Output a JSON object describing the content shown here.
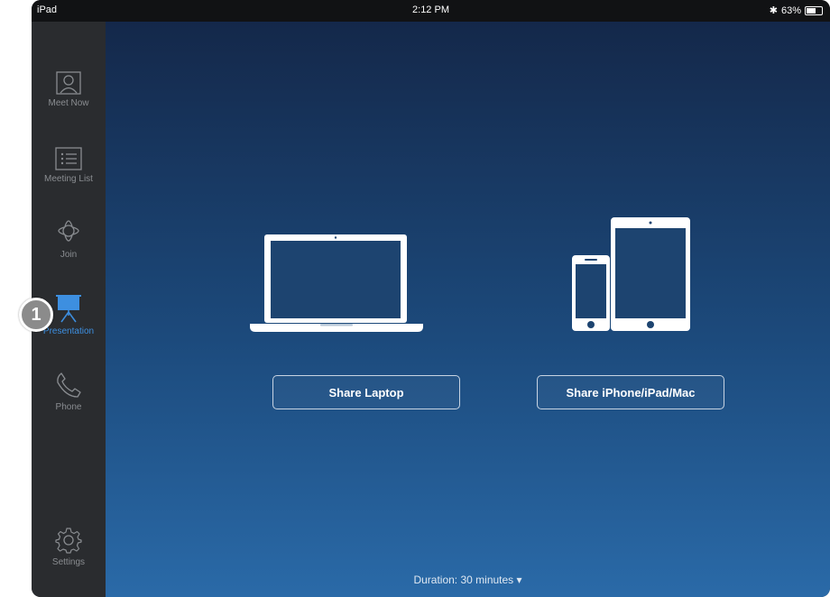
{
  "status_bar": {
    "device": "iPad",
    "time": "2:12 PM",
    "battery": "63%",
    "battery_level": 0.63
  },
  "sidebar": {
    "items": [
      {
        "label": "Meet Now",
        "icon": "person-icon"
      },
      {
        "label": "Meeting List",
        "icon": "list-icon"
      },
      {
        "label": "Join",
        "icon": "join-icon"
      },
      {
        "label": "Presentation",
        "icon": "projector-icon"
      },
      {
        "label": "Phone",
        "icon": "phone-icon"
      }
    ],
    "settings": {
      "label": "Settings",
      "icon": "gear-icon"
    },
    "active_index": 3
  },
  "main": {
    "share_laptop_label": "Share Laptop",
    "share_devices_label": "Share iPhone/iPad/Mac",
    "duration": "Duration: 30 minutes ▾"
  },
  "annotation": {
    "step": "1"
  },
  "colors": {
    "accent": "#3d8fe0",
    "sidebar_bg": "#2a2c2f",
    "main_gradient_top": "#14284a",
    "main_gradient_bottom": "#2a6aa8"
  }
}
